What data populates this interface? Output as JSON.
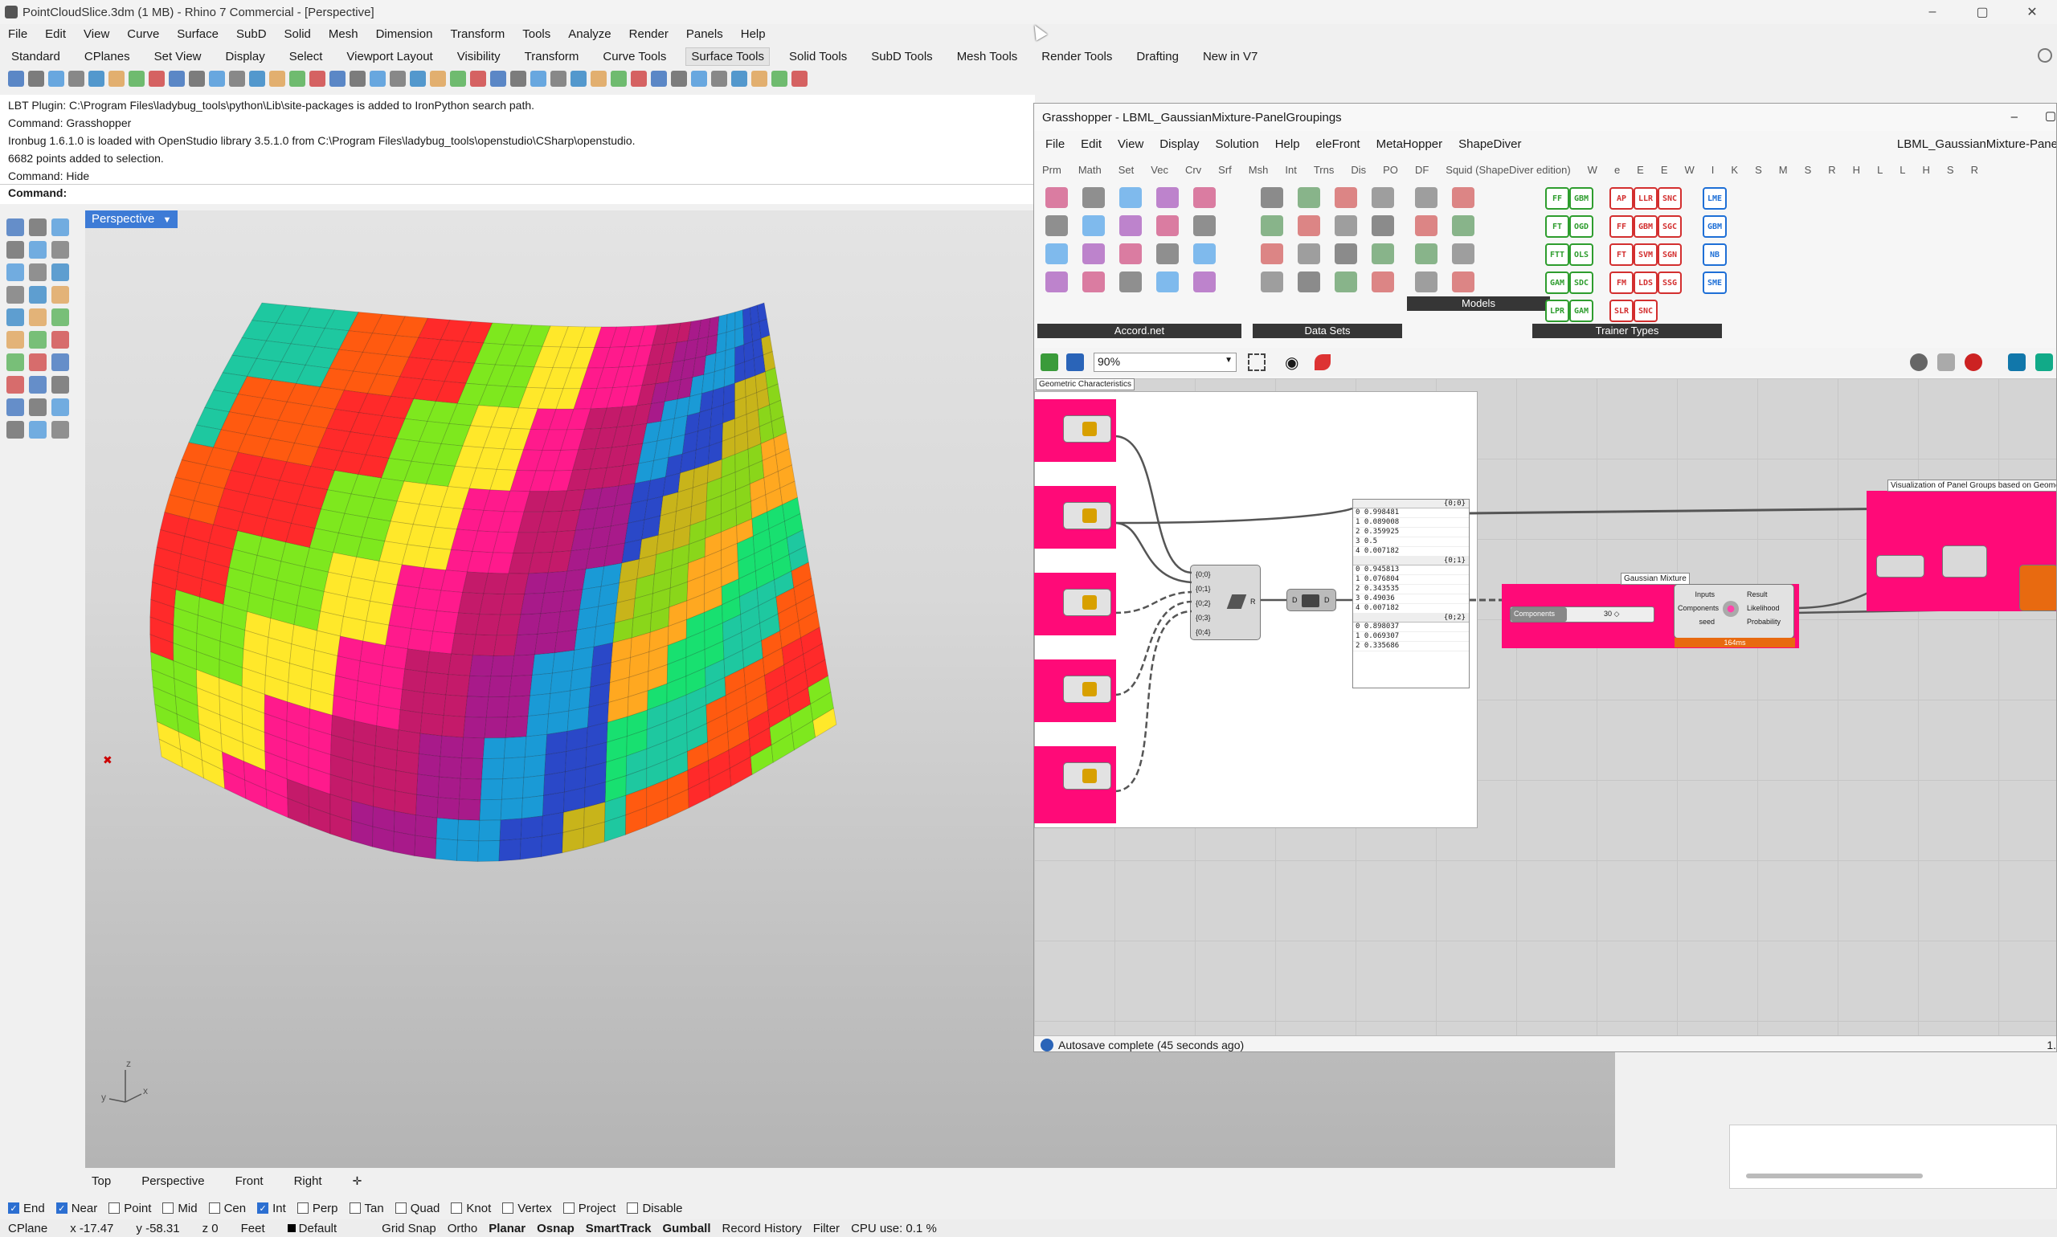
{
  "window": {
    "title": "PointCloudSlice.3dm (1 MB) - Rhino 7 Commercial - [Perspective]",
    "controls": [
      "–",
      "▢",
      "✕"
    ]
  },
  "menu": [
    "File",
    "Edit",
    "View",
    "Curve",
    "Surface",
    "SubD",
    "Solid",
    "Mesh",
    "Dimension",
    "Transform",
    "Tools",
    "Analyze",
    "Render",
    "Panels",
    "Help"
  ],
  "tabs": [
    "Standard",
    "CPlanes",
    "Set View",
    "Display",
    "Select",
    "Viewport Layout",
    "Visibility",
    "Transform",
    "Curve Tools",
    "Surface Tools",
    "Solid Tools",
    "SubD Tools",
    "Mesh Tools",
    "Render Tools",
    "Drafting",
    "New in V7"
  ],
  "active_tab": "Surface Tools",
  "command_history": [
    "LBT Plugin: C:\\Program Files\\ladybug_tools\\python\\Lib\\site-packages is added to IronPython search path.",
    "Command: Grasshopper",
    "Ironbug 1.6.1.0 is loaded with OpenStudio library 3.5.1.0 from C:\\Program Files\\ladybug_tools\\openstudio\\CSharp\\openstudio.",
    "6682 points added to selection.",
    "Command: Hide"
  ],
  "command_prompt": "Command:",
  "viewport": {
    "label": "Perspective",
    "tabs": [
      "Top",
      "Perspective",
      "Front",
      "Right"
    ]
  },
  "snaps": [
    {
      "label": "End",
      "on": true
    },
    {
      "label": "Near",
      "on": true
    },
    {
      "label": "Point",
      "on": false
    },
    {
      "label": "Mid",
      "on": false
    },
    {
      "label": "Cen",
      "on": false
    },
    {
      "label": "Int",
      "on": true
    },
    {
      "label": "Perp",
      "on": false
    },
    {
      "label": "Tan",
      "on": false
    },
    {
      "label": "Quad",
      "on": false
    },
    {
      "label": "Knot",
      "on": false
    },
    {
      "label": "Vertex",
      "on": false
    },
    {
      "label": "Project",
      "on": false
    },
    {
      "label": "Disable",
      "on": false
    }
  ],
  "status": {
    "cplane": "CPlane",
    "x": "x -17.47",
    "y": "y -58.31",
    "z": "z 0",
    "units": "Feet",
    "layer": "Default",
    "toggles": [
      "Grid Snap",
      "Ortho",
      "Planar",
      "Osnap",
      "SmartTrack",
      "Gumball",
      "Record History",
      "Filter"
    ],
    "bold_toggles": [
      "Planar",
      "Osnap",
      "SmartTrack",
      "Gumball"
    ],
    "cpu": "CPU use: 0.1 %"
  },
  "grasshopper": {
    "title": "Grasshopper - LBML_GaussianMixture-PanelGroupings",
    "doc_name": "LBML_GaussianMixture-Pane",
    "menu": [
      "File",
      "Edit",
      "View",
      "Display",
      "Solution",
      "Help",
      "eleFront",
      "MetaHopper",
      "ShapeDiver"
    ],
    "categories": [
      "Prm",
      "Math",
      "Set",
      "Vec",
      "Crv",
      "Srf",
      "Msh",
      "Int",
      "Trns",
      "Dis",
      "PO",
      "DF",
      "Squid (ShapeDiver edition)",
      "W",
      "e",
      "E",
      "E",
      "W",
      "I",
      "K",
      "S",
      "M",
      "S",
      "R",
      "H",
      "L",
      "L",
      "H",
      "S",
      "R"
    ],
    "ribbon_groups": [
      "Accord.net",
      "Data Sets",
      "Models",
      "Trainer Types"
    ],
    "trainer_icons": [
      "FF",
      "GBM",
      "AP",
      "LLR",
      "SNC",
      "LME",
      "FT",
      "OGD",
      "FF",
      "GBM",
      "SGC",
      "GBM",
      "FTT",
      "OLS",
      "FT",
      "SVM",
      "SGN",
      "NB",
      "GAM",
      "SDC",
      "FM",
      "LDS",
      "SSG",
      "SME",
      "LPR",
      "GAM",
      "SLR",
      "SNC"
    ],
    "zoom": "90%",
    "canvas": {
      "group_geo": "Geometric Characteristics",
      "group_gmm": "Gaussian Mixture",
      "group_vis": "Visualization of Panel Groups based on Geome",
      "merge_inputs": [
        "{0;0}",
        "{0;1}",
        "{0;2}",
        "{0;3}",
        "{0;4}"
      ],
      "panel_branches": [
        {
          "path": "{0;0}",
          "rows": [
            "0 0.998481",
            "1 0.089008",
            "2 0.359925",
            "3 0.5",
            "4 0.007182"
          ]
        },
        {
          "path": "{0;1}",
          "rows": [
            "0 0.945813",
            "1 0.076804",
            "2 0.343535",
            "3 0.49036",
            "4 0.007182"
          ]
        },
        {
          "path": "{0;2}",
          "rows": [
            "0 0.898037",
            "1 0.069307",
            "2 0.335686"
          ]
        }
      ],
      "slider_label": "Components",
      "slider_value": "30 ◇",
      "gmm_inputs": [
        "Inputs",
        "Components",
        "seed"
      ],
      "gmm_outputs": [
        "Result",
        "Likelihood",
        "Probability"
      ],
      "gmm_time": "164ms"
    },
    "status": "Autosave complete (45 seconds ago)",
    "status_right": "1."
  }
}
